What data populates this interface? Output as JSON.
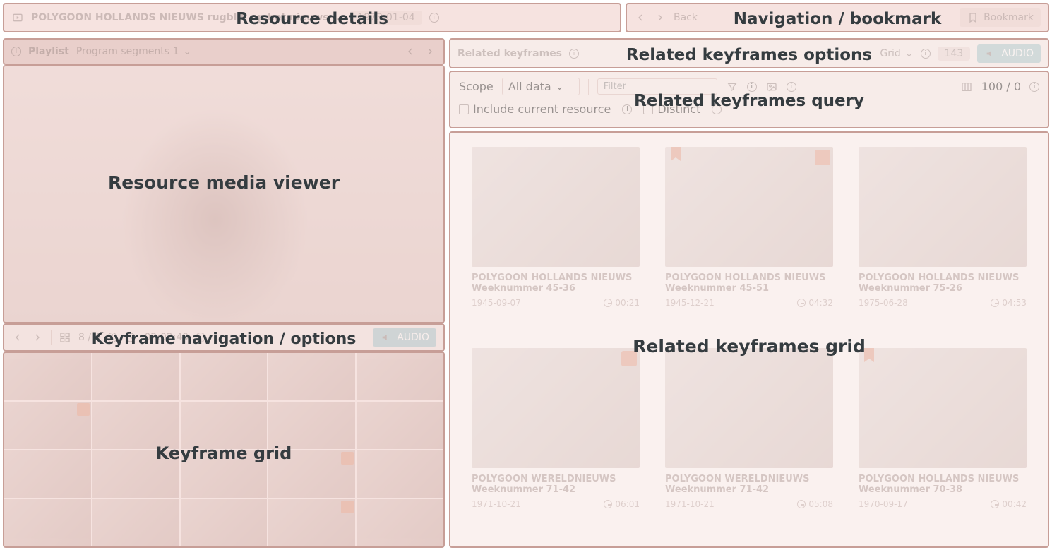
{
  "labels": {
    "resource_details": "Resource details",
    "nav_bookmark": "Navigation / bookmark",
    "media_viewer": "Resource media viewer",
    "kf_nav": "Keyframe navigation / options",
    "kf_grid": "Keyframe grid",
    "rk_options": "Related keyframes options",
    "rk_query": "Related keyframes query",
    "rk_grid": "Related keyframes grid"
  },
  "header": {
    "title": "POLYGOON HOLLANDS NIEUWS               rugblik op het nieuws ...",
    "date": "1973-01-04",
    "back": "Back",
    "bookmark": "Bookmark"
  },
  "playlist": {
    "label": "Playlist",
    "value": "Program segments 1"
  },
  "viewer": {
    "index": "8 / 4",
    "timecode": "02:02:49",
    "audio": "AUDIO"
  },
  "related_options": {
    "title": "Related keyframes",
    "layout": "Grid",
    "count": "143",
    "audio": "AUDIO"
  },
  "related_query": {
    "scope_label": "Scope",
    "scope_value": "All data",
    "filter_placeholder": "Filter",
    "include_label": "Include current resource",
    "distinct_label": "Distinct",
    "paging": "100 / 0"
  },
  "cards": [
    {
      "t1": "POLYGOON HOLLANDS NIEUWS",
      "t2": "Weeknummer 45-36",
      "date": "1945-09-07",
      "tc": "00:21",
      "bk": false,
      "tg": false
    },
    {
      "t1": "POLYGOON HOLLANDS NIEUWS",
      "t2": "Weeknummer 45-51",
      "date": "1945-12-21",
      "tc": "04:32",
      "bk": true,
      "tg": true
    },
    {
      "t1": "POLYGOON HOLLANDS NIEUWS",
      "t2": "Weeknummer 75-26",
      "date": "1975-06-28",
      "tc": "04:53",
      "bk": false,
      "tg": false
    },
    {
      "t1": "POLYGOON WERELDNIEUWS",
      "t2": "Weeknummer 71-42",
      "date": "1971-10-21",
      "tc": "06:01",
      "bk": false,
      "tg": true
    },
    {
      "t1": "POLYGOON WERELDNIEUWS",
      "t2": "Weeknummer 71-42",
      "date": "1971-10-21",
      "tc": "05:08",
      "bk": false,
      "tg": false
    },
    {
      "t1": "POLYGOON HOLLANDS NIEUWS",
      "t2": "Weeknummer 70-38",
      "date": "1970-09-17",
      "tc": "00:42",
      "bk": true,
      "tg": false
    }
  ]
}
